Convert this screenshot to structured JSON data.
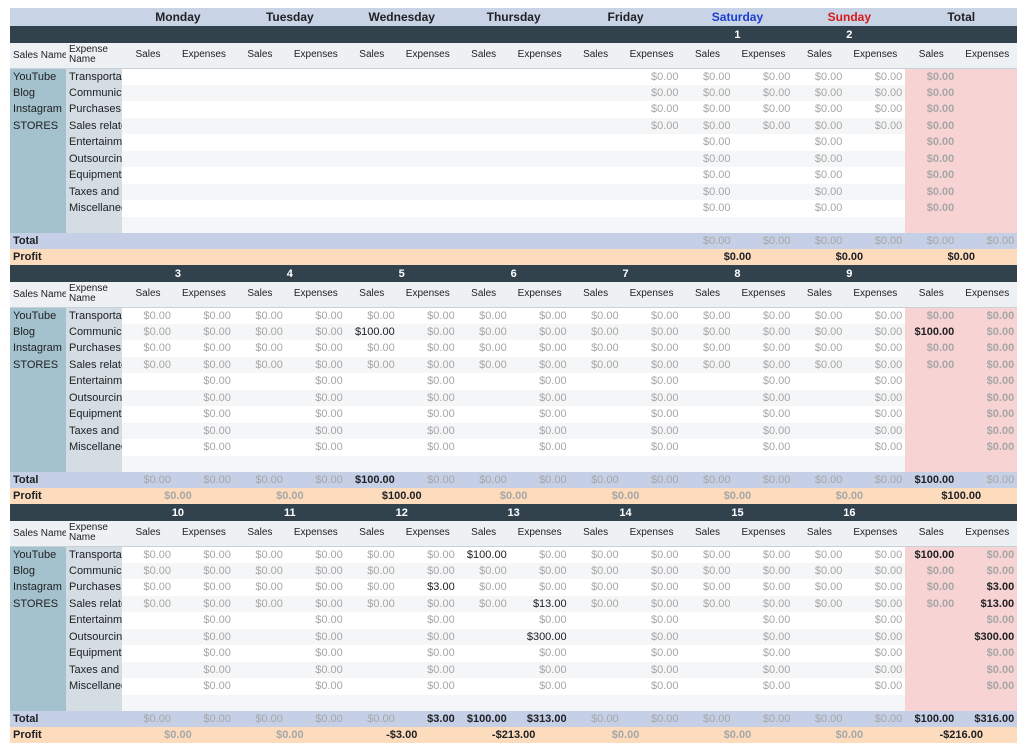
{
  "days": [
    "Monday",
    "Tuesday",
    "Wednesday",
    "Thursday",
    "Friday",
    "Saturday",
    "Sunday",
    "Total"
  ],
  "labels": {
    "sales_name": "Sales Name",
    "expense_name_1": "Expense",
    "expense_name_2": "Name",
    "sales": "Sales",
    "expenses": "Expenses",
    "total": "Total",
    "profit": "Profit"
  },
  "sales_names": [
    "YouTube",
    "Blog",
    "Instagram",
    "STORES"
  ],
  "expense_names": [
    "Transportat",
    "Communica",
    "Purchases c",
    "Sales relate",
    "Entertainme",
    "Outsourcing",
    "Equipment",
    "Taxes and i",
    "Miscellaneo"
  ],
  "weeks": [
    {
      "days": [
        "",
        "",
        "",
        "",
        "",
        "1",
        "2"
      ],
      "cells": [
        [
          "",
          "",
          "",
          "",
          "",
          "",
          "",
          "",
          "",
          "$0.00",
          "$0.00",
          "$0.00",
          "$0.00",
          "$0.00",
          "$0.00"
        ],
        [
          "",
          "",
          "",
          "",
          "",
          "",
          "",
          "",
          "",
          "$0.00",
          "$0.00",
          "$0.00",
          "$0.00",
          "$0.00",
          "$0.00"
        ],
        [
          "",
          "",
          "",
          "",
          "",
          "",
          "",
          "",
          "",
          "$0.00",
          "$0.00",
          "$0.00",
          "$0.00",
          "$0.00",
          "$0.00"
        ],
        [
          "",
          "",
          "",
          "",
          "",
          "",
          "",
          "",
          "",
          "$0.00",
          "$0.00",
          "$0.00",
          "$0.00",
          "$0.00",
          "$0.00"
        ],
        [
          "",
          "",
          "",
          "",
          "",
          "",
          "",
          "",
          "",
          "",
          "$0.00",
          "",
          "$0.00",
          "",
          "$0.00"
        ],
        [
          "",
          "",
          "",
          "",
          "",
          "",
          "",
          "",
          "",
          "",
          "$0.00",
          "",
          "$0.00",
          "",
          "$0.00"
        ],
        [
          "",
          "",
          "",
          "",
          "",
          "",
          "",
          "",
          "",
          "",
          "$0.00",
          "",
          "$0.00",
          "",
          "$0.00"
        ],
        [
          "",
          "",
          "",
          "",
          "",
          "",
          "",
          "",
          "",
          "",
          "$0.00",
          "",
          "$0.00",
          "",
          "$0.00"
        ],
        [
          "",
          "",
          "",
          "",
          "",
          "",
          "",
          "",
          "",
          "",
          "$0.00",
          "",
          "$0.00",
          "",
          "$0.00"
        ]
      ],
      "totals": [
        "",
        "",
        "",
        "",
        "",
        "",
        "",
        "",
        "",
        "",
        "$0.00",
        "$0.00",
        "$0.00",
        "$0.00",
        "$0.00",
        "$0.00"
      ],
      "profits": [
        "",
        "",
        "",
        "",
        "",
        "$0.00",
        "$0.00",
        "$0.00"
      ]
    },
    {
      "days": [
        "3",
        "4",
        "5",
        "6",
        "7",
        "8",
        "9"
      ],
      "cells": [
        [
          "$0.00",
          "$0.00",
          "$0.00",
          "$0.00",
          "$0.00",
          "$0.00",
          "$0.00",
          "$0.00",
          "$0.00",
          "$0.00",
          "$0.00",
          "$0.00",
          "$0.00",
          "$0.00",
          "$0.00",
          "$0.00"
        ],
        [
          "$0.00",
          "$0.00",
          "$0.00",
          "$0.00",
          "$100.00",
          "$0.00",
          "$0.00",
          "$0.00",
          "$0.00",
          "$0.00",
          "$0.00",
          "$0.00",
          "$0.00",
          "$0.00",
          "$100.00",
          "$0.00"
        ],
        [
          "$0.00",
          "$0.00",
          "$0.00",
          "$0.00",
          "$0.00",
          "$0.00",
          "$0.00",
          "$0.00",
          "$0.00",
          "$0.00",
          "$0.00",
          "$0.00",
          "$0.00",
          "$0.00",
          "$0.00",
          "$0.00"
        ],
        [
          "$0.00",
          "$0.00",
          "$0.00",
          "$0.00",
          "$0.00",
          "$0.00",
          "$0.00",
          "$0.00",
          "$0.00",
          "$0.00",
          "$0.00",
          "$0.00",
          "$0.00",
          "$0.00",
          "$0.00",
          "$0.00"
        ],
        [
          "",
          "$0.00",
          "",
          "$0.00",
          "",
          "$0.00",
          "",
          "$0.00",
          "",
          "$0.00",
          "",
          "$0.00",
          "",
          "$0.00",
          "",
          "$0.00"
        ],
        [
          "",
          "$0.00",
          "",
          "$0.00",
          "",
          "$0.00",
          "",
          "$0.00",
          "",
          "$0.00",
          "",
          "$0.00",
          "",
          "$0.00",
          "",
          "$0.00"
        ],
        [
          "",
          "$0.00",
          "",
          "$0.00",
          "",
          "$0.00",
          "",
          "$0.00",
          "",
          "$0.00",
          "",
          "$0.00",
          "",
          "$0.00",
          "",
          "$0.00"
        ],
        [
          "",
          "$0.00",
          "",
          "$0.00",
          "",
          "$0.00",
          "",
          "$0.00",
          "",
          "$0.00",
          "",
          "$0.00",
          "",
          "$0.00",
          "",
          "$0.00"
        ],
        [
          "",
          "$0.00",
          "",
          "$0.00",
          "",
          "$0.00",
          "",
          "$0.00",
          "",
          "$0.00",
          "",
          "$0.00",
          "",
          "$0.00",
          "",
          "$0.00"
        ]
      ],
      "totals": [
        "$0.00",
        "$0.00",
        "$0.00",
        "$0.00",
        "$100.00",
        "$0.00",
        "$0.00",
        "$0.00",
        "$0.00",
        "$0.00",
        "$0.00",
        "$0.00",
        "$0.00",
        "$0.00",
        "$100.00",
        "$0.00"
      ],
      "profits": [
        "$0.00",
        "$0.00",
        "$100.00",
        "$0.00",
        "$0.00",
        "$0.00",
        "$0.00",
        "$100.00"
      ]
    },
    {
      "days": [
        "10",
        "11",
        "12",
        "13",
        "14",
        "15",
        "16"
      ],
      "cells": [
        [
          "$0.00",
          "$0.00",
          "$0.00",
          "$0.00",
          "$0.00",
          "$0.00",
          "$100.00",
          "$0.00",
          "$0.00",
          "$0.00",
          "$0.00",
          "$0.00",
          "$0.00",
          "$0.00",
          "$100.00",
          "$0.00"
        ],
        [
          "$0.00",
          "$0.00",
          "$0.00",
          "$0.00",
          "$0.00",
          "$0.00",
          "$0.00",
          "$0.00",
          "$0.00",
          "$0.00",
          "$0.00",
          "$0.00",
          "$0.00",
          "$0.00",
          "$0.00",
          "$0.00"
        ],
        [
          "$0.00",
          "$0.00",
          "$0.00",
          "$0.00",
          "$0.00",
          "$3.00",
          "$0.00",
          "$0.00",
          "$0.00",
          "$0.00",
          "$0.00",
          "$0.00",
          "$0.00",
          "$0.00",
          "$0.00",
          "$3.00"
        ],
        [
          "$0.00",
          "$0.00",
          "$0.00",
          "$0.00",
          "$0.00",
          "$0.00",
          "$0.00",
          "$13.00",
          "$0.00",
          "$0.00",
          "$0.00",
          "$0.00",
          "$0.00",
          "$0.00",
          "$0.00",
          "$13.00"
        ],
        [
          "",
          "$0.00",
          "",
          "$0.00",
          "",
          "$0.00",
          "",
          "$0.00",
          "",
          "$0.00",
          "",
          "$0.00",
          "",
          "$0.00",
          "",
          "$0.00"
        ],
        [
          "",
          "$0.00",
          "",
          "$0.00",
          "",
          "$0.00",
          "",
          "$300.00",
          "",
          "$0.00",
          "",
          "$0.00",
          "",
          "$0.00",
          "",
          "$300.00"
        ],
        [
          "",
          "$0.00",
          "",
          "$0.00",
          "",
          "$0.00",
          "",
          "$0.00",
          "",
          "$0.00",
          "",
          "$0.00",
          "",
          "$0.00",
          "",
          "$0.00"
        ],
        [
          "",
          "$0.00",
          "",
          "$0.00",
          "",
          "$0.00",
          "",
          "$0.00",
          "",
          "$0.00",
          "",
          "$0.00",
          "",
          "$0.00",
          "",
          "$0.00"
        ],
        [
          "",
          "$0.00",
          "",
          "$0.00",
          "",
          "$0.00",
          "",
          "$0.00",
          "",
          "$0.00",
          "",
          "$0.00",
          "",
          "$0.00",
          "",
          "$0.00"
        ]
      ],
      "totals": [
        "$0.00",
        "$0.00",
        "$0.00",
        "$0.00",
        "$0.00",
        "$3.00",
        "$100.00",
        "$313.00",
        "$0.00",
        "$0.00",
        "$0.00",
        "$0.00",
        "$0.00",
        "$0.00",
        "$100.00",
        "$316.00"
      ],
      "profits": [
        "$0.00",
        "$0.00",
        "-$3.00",
        "-$213.00",
        "$0.00",
        "$0.00",
        "$0.00",
        "-$216.00"
      ]
    }
  ],
  "colors": {
    "header_dark": "#32424c",
    "day_header": "#c9d3e6",
    "saturday": "#1a3fcf",
    "sunday": "#d41b1b",
    "sales_name_col": "#a4c2cd",
    "expense_name_col": "#d4dde3",
    "total_col": "#f7d4d3",
    "total_row": "#c5cfe6",
    "profit_row": "#fddcbd"
  }
}
